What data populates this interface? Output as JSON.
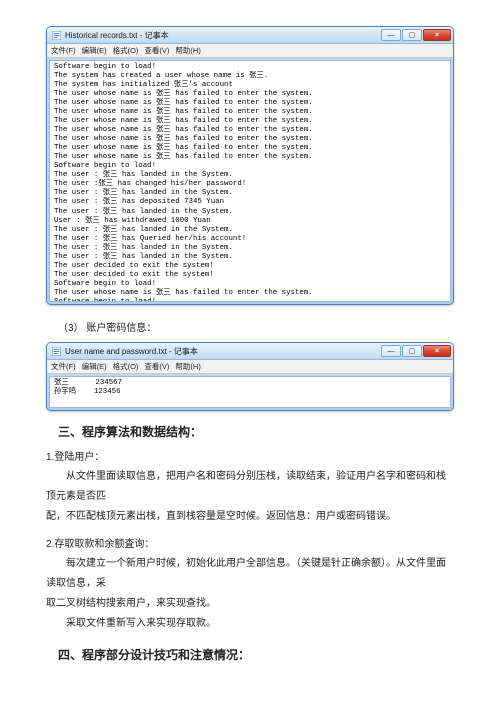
{
  "window1": {
    "title": "Historical records.txt - 记事本",
    "menu": [
      "文件(F)",
      "编辑(E)",
      "格式(O)",
      "查看(V)",
      "帮助(H)"
    ],
    "min": "—",
    "max": "▢",
    "close": "×",
    "content": "Software begin to load!\nThe system has created a user whose name is 张三.\nThe system has initialized 张三's account\nThe user whose name is 张三 has failed to enter the system.\nThe user whose name is 张三 has failed to enter the system.\nThe user whose name is 张三 has failed to enter the system.\nThe user whose name is 张三 has failed to enter the system.\nThe user whose name is 张三 has failed to enter the system.\nThe user whose name is 张三 has failed to enter the system.\nThe user whose name is 张三 has failed to enter the system.\nThe user whose name is 张三 has failed to enter the system.\nSoftware begin to load!\nThe user : 张三 has landed in the System.\nThe user :张三 has changed his/her password!\nThe user : 张三 has landed in the System.\nThe user : 张三 has deposited 7345 Yuan\nThe user : 张三 has landed in the System.\nUser : 张三 has withdrawed 1000 Yuan\nThe user : 张三 has landed in the System.\nThe user : 张三 has Queried her/his account!\nThe user : 张三 has landed in the System.\nThe user : 张三 has landed in the System.\nThe user decided to exit the system!\nThe user decided to exit the system!\nSoftware begin to load!\nThe user whose name is 张三 has failed to enter the system.\nSoftware begin to load!\nThe system has created a user whose name is 孙宇鸣.\nThe system has initialized 孙宇鸣's account\nThe user : 孙宇鸣 has landed in the System."
  },
  "caption1": "（3）   账户密码信息：",
  "window2": {
    "title": "User name and password.txt - 记事本",
    "menu": [
      "文件(F)",
      "编辑(E)",
      "格式(O)",
      "查看(V)",
      "帮助(H)"
    ],
    "min": "—",
    "max": "▢",
    "close": "×",
    "content": "张三      234567\n孙宇鸣    123456"
  },
  "section3": {
    "heading": "三、程序算法和数据结构：",
    "items": {
      "i1_num": "1.登陆用户：",
      "i1_body1": "从文件里面读取信息，把用户名和密码分别压栈，读取结束，验证用户名字和密码和栈顶元素是否匹",
      "i1_body2": "配，不匹配栈顶元素出栈，直到栈容量是空时候。返回信息：用户或密码错误。",
      "i2_num": "2.存取取款和余额査询：",
      "i2_body1": "每次建立一个新用户时候，初始化此用户全部信息。（关键是针正确余额）。从文件里面读取信息，采",
      "i2_body2": "取二叉树结构搜索用户，来实现查找。",
      "i2_body3": "采取文件重新写入来实现存取款。"
    }
  },
  "section4": {
    "heading": "四、程序部分设计技巧和注意情况："
  }
}
